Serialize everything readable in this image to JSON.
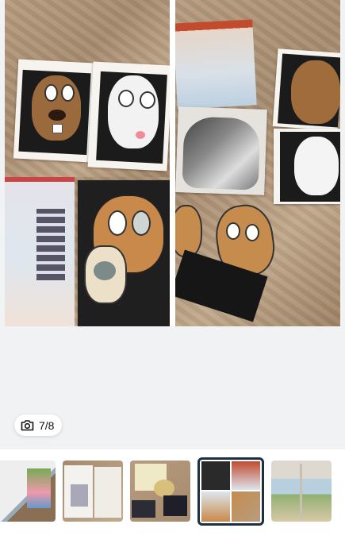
{
  "viewer": {
    "counter": "7/8",
    "camera_icon": "camera-icon"
  },
  "thumbnails": [
    {
      "name": "thumbnail-1",
      "selected": false
    },
    {
      "name": "thumbnail-2",
      "selected": false
    },
    {
      "name": "thumbnail-3",
      "selected": false
    },
    {
      "name": "thumbnail-4",
      "selected": true
    },
    {
      "name": "thumbnail-5",
      "selected": false
    }
  ],
  "colors": {
    "background": "#f1f2f4",
    "selected_border": "#1b3040"
  }
}
